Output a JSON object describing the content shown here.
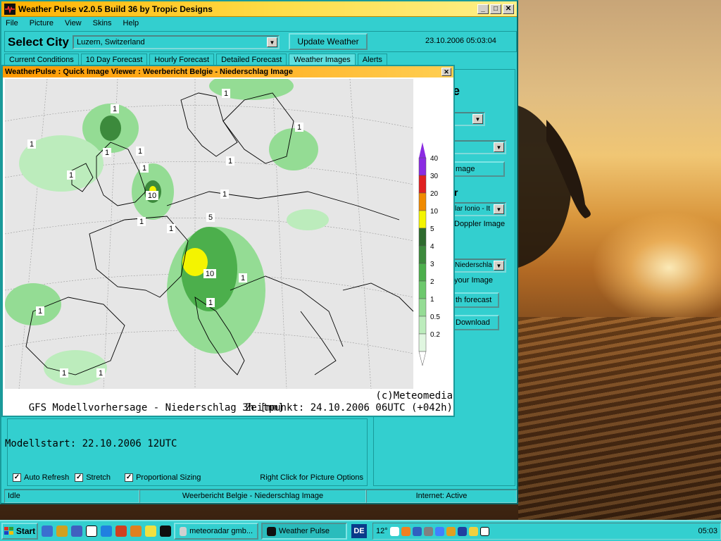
{
  "app": {
    "title": "Weather Pulse v2.0.5 Build 36 by Tropic Designs",
    "menu": [
      "File",
      "Picture",
      "View",
      "Skins",
      "Help"
    ],
    "select_city_label": "Select City",
    "city_value": "Luzern, Switzerland",
    "update_button": "Update Weather",
    "datetime": "23.10.2006 05:03:04",
    "tabs": [
      "Current Conditions",
      "10 Day Forecast",
      "Hourly Forecast",
      "Detailed Forecast",
      "Weather Images",
      "Alerts"
    ],
    "active_tab": "Weather Images"
  },
  "right_panel": {
    "heading_fragment": "e",
    "dropdown1_value": "",
    "dropdown2_value": "",
    "button1": "mage",
    "label_r": "r",
    "dropdown3_value": "lar Ionio - It",
    "doppler_link": "Doppler Image",
    "dropdown4_value": "Niederschla",
    "your_image_link": "your Image",
    "forecast_button": "th forecast",
    "download_button": "Download"
  },
  "options": {
    "auto_refresh": {
      "label": "Auto Refresh",
      "checked": true
    },
    "stretch": {
      "label": "Stretch",
      "checked": true
    },
    "proportional": {
      "label": "Proportional Sizing",
      "checked": true
    },
    "right_click_hint": "Right Click for Picture Options"
  },
  "status": {
    "left": "Idle",
    "middle": "Weerbericht Belgie - Niederschlag Image",
    "right": "Internet: Active"
  },
  "viewer": {
    "title": "WeatherPulse : Quick Image Viewer : Weerbericht Belgie - Niederschlag Image",
    "caption_line1_left": "GFS Modellvorhersage - Niederschlag 3h [mm]",
    "caption_line1_right": "(c)Meteomedia",
    "caption_line2_left": "Modellstart: 22.10.2006 12UTC",
    "caption_line2_right": "Zeitpunkt: 24.10.2006 06UTC (+042h)",
    "legend": [
      {
        "label": "40",
        "color": "#8a2be2"
      },
      {
        "label": "30",
        "color": "#e02020"
      },
      {
        "label": "20",
        "color": "#f08a00"
      },
      {
        "label": "10",
        "color": "#f4f400"
      },
      {
        "label": "5",
        "color": "#2e6b2e"
      },
      {
        "label": "4",
        "color": "#3c8a3c"
      },
      {
        "label": "3",
        "color": "#4caf4c"
      },
      {
        "label": "2",
        "color": "#6cc86c"
      },
      {
        "label": "1",
        "color": "#94dc94"
      },
      {
        "label": "0.5",
        "color": "#bcecbc"
      },
      {
        "label": "0.2",
        "color": "#e0f6e0"
      }
    ],
    "map_labels": [
      "1",
      "1",
      "1",
      "1",
      "1",
      "1",
      "1",
      "1",
      "1",
      "10",
      "1",
      "1",
      "1",
      "5",
      "10",
      "1",
      "1",
      "1",
      "1",
      "1"
    ]
  },
  "taskbar": {
    "start": "Start",
    "tasks": [
      "meteoradar gmb...",
      "Weather Pulse"
    ],
    "active_task": "Weather Pulse",
    "language": "DE",
    "temp": "12°",
    "clock": "05:03"
  }
}
